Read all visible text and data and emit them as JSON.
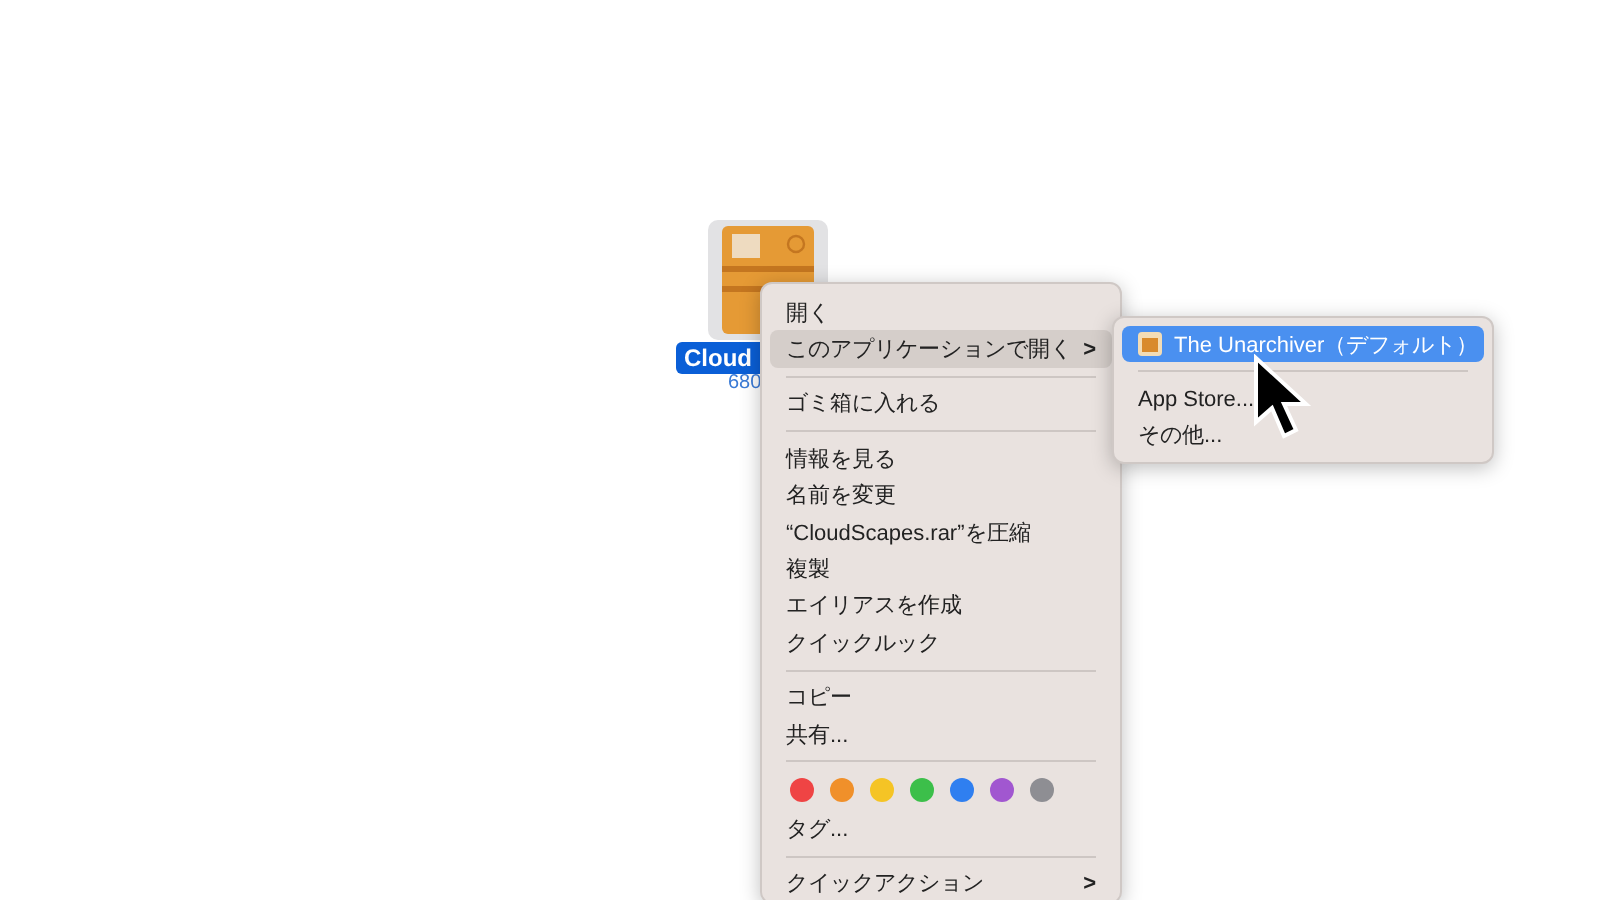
{
  "file": {
    "name": "Cloud",
    "size": "680",
    "selected": true
  },
  "context_menu": {
    "items": [
      {
        "kind": "item",
        "label": "開く",
        "selected": false
      },
      {
        "kind": "submenu",
        "label": "このアプリケーションで開く",
        "arrow": ">",
        "selected": true
      },
      {
        "kind": "separator"
      },
      {
        "kind": "item",
        "label": "ゴミ箱に入れる",
        "selected": false
      },
      {
        "kind": "separator"
      },
      {
        "kind": "item",
        "label": "情報を見る",
        "selected": false
      },
      {
        "kind": "item",
        "label": "名前を変更",
        "selected": false
      },
      {
        "kind": "item",
        "label": "“CloudScapes.rar”を圧縮",
        "selected": false
      },
      {
        "kind": "item",
        "label": "複製",
        "selected": false
      },
      {
        "kind": "item",
        "label": "エイリアスを作成",
        "selected": false
      },
      {
        "kind": "item",
        "label": "クイックルック",
        "selected": false
      },
      {
        "kind": "separator"
      },
      {
        "kind": "item",
        "label": "コピー",
        "selected": false
      },
      {
        "kind": "item",
        "label": "共有...",
        "selected": false
      },
      {
        "kind": "separator"
      },
      {
        "kind": "colors",
        "tags": [
          {
            "color": "#ef4444"
          },
          {
            "color": "#f0902a"
          },
          {
            "color": "#f5c425"
          },
          {
            "color": "#3cbf4a"
          },
          {
            "color": "#2f7ff0"
          },
          {
            "color": "#a157d0"
          },
          {
            "color": "#8e8e93"
          }
        ]
      },
      {
        "kind": "item",
        "label": "タグ...",
        "selected": false
      },
      {
        "kind": "separator"
      },
      {
        "kind": "submenu",
        "label": "クイックアクション",
        "arrow": ">",
        "selected": false
      }
    ]
  },
  "submenu": {
    "items": [
      {
        "kind": "app",
        "label": "The Unarchiver（デフォルト）",
        "selected": true
      },
      {
        "kind": "separator"
      },
      {
        "kind": "item",
        "label": "App Store...",
        "selected": false
      },
      {
        "kind": "item",
        "label": "その他...",
        "selected": false
      }
    ]
  }
}
